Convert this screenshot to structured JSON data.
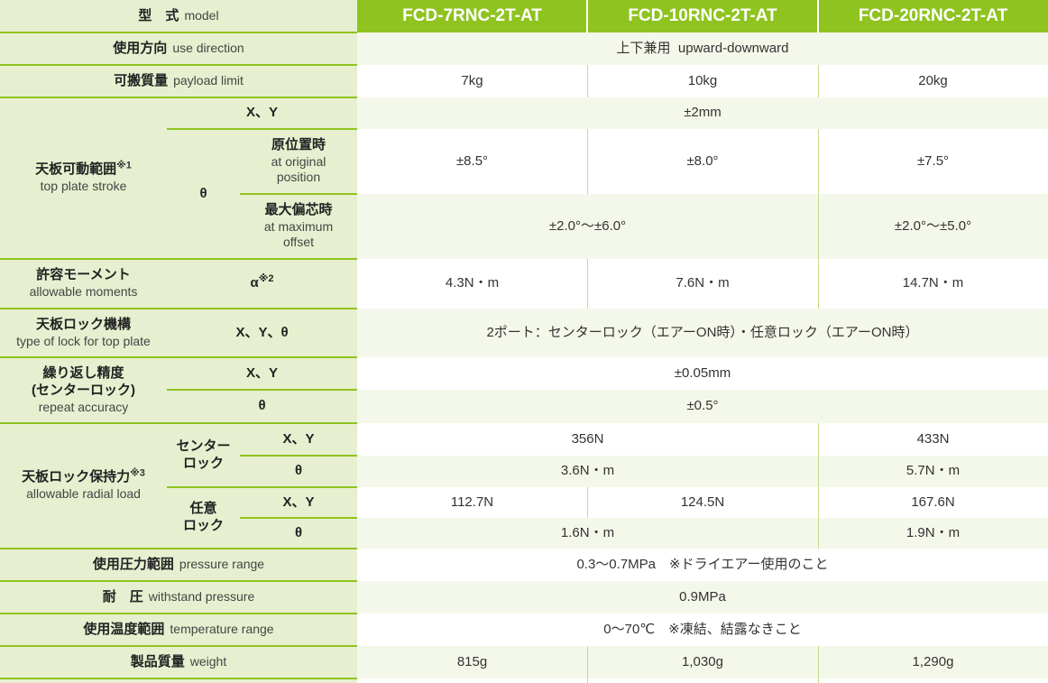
{
  "header": {
    "label_jp": "型　式",
    "label_en": "model",
    "models": [
      "FCD-7RNC-2T-AT",
      "FCD-10RNC-2T-AT",
      "FCD-20RNC-2T-AT"
    ]
  },
  "rows": {
    "use_direction": {
      "jp": "使用方向",
      "en": "use direction",
      "value": "上下兼用  upward-downward"
    },
    "payload": {
      "jp": "可搬質量",
      "en": "payload limit",
      "values": [
        "7kg",
        "10kg",
        "20kg"
      ]
    },
    "stroke": {
      "jp": "天板可動範囲",
      "note": "※1",
      "en": "top plate stroke",
      "xy_label": "X、Y",
      "xy_value": "±2mm",
      "theta_label": "θ",
      "orig_jp": "原位置時",
      "orig_en1": "at original",
      "orig_en2": "position",
      "orig_values": [
        "±8.5°",
        "±8.0°",
        "±7.5°"
      ],
      "max_jp": "最大偏芯時",
      "max_en1": "at maximum",
      "max_en2": "offset",
      "max_values": [
        "±2.0°～±6.0°",
        "±2.0°～±5.0°"
      ]
    },
    "moment": {
      "jp": "許容モーメント",
      "en": "allowable moments",
      "sub": "α",
      "note": "※2",
      "values": [
        "4.3N・m",
        "7.6N・m",
        "14.7N・m"
      ]
    },
    "lock_type": {
      "jp": "天板ロック機構",
      "en": "type of lock for top plate",
      "sub": "X、Y、θ",
      "value": "2ポート：センターロック（エアーON時）・任意ロック（エアーON時）"
    },
    "repeat": {
      "jp1": "繰り返し精度",
      "jp2": "(センターロック)",
      "en": "repeat accuracy",
      "xy_label": "X、Y",
      "xy_value": "±0.05mm",
      "theta_label": "θ",
      "theta_value": "±0.5°"
    },
    "holding": {
      "jp": "天板ロック保持力",
      "note": "※3",
      "en": "allowable radial load",
      "center_jp1": "センター",
      "center_jp2": "ロック",
      "center_xy_label": "X、Y",
      "center_xy_values": [
        "356N",
        "433N"
      ],
      "center_theta_label": "θ",
      "center_theta_values": [
        "3.6N・m",
        "5.7N・m"
      ],
      "any_jp1": "任意",
      "any_jp2": "ロック",
      "any_xy_label": "X、Y",
      "any_xy_values": [
        "112.7N",
        "124.5N",
        "167.6N"
      ],
      "any_theta_label": "θ",
      "any_theta_values": [
        "1.6N・m",
        "1.9N・m"
      ]
    },
    "pressure": {
      "jp": "使用圧力範囲",
      "en": "pressure range",
      "value": "0.3～0.7MPa　※ドライエアー使用のこと"
    },
    "withstand": {
      "jp": "耐　圧",
      "en": "withstand pressure",
      "value": "0.9MPa"
    },
    "temperature": {
      "jp": "使用温度範囲",
      "en": "temperature range",
      "value": "0～70℃　※凍結、結露なきこと"
    },
    "weight": {
      "jp": "製品質量",
      "en": "weight",
      "values": [
        "815g",
        "1,030g",
        "1,290g"
      ]
    }
  }
}
